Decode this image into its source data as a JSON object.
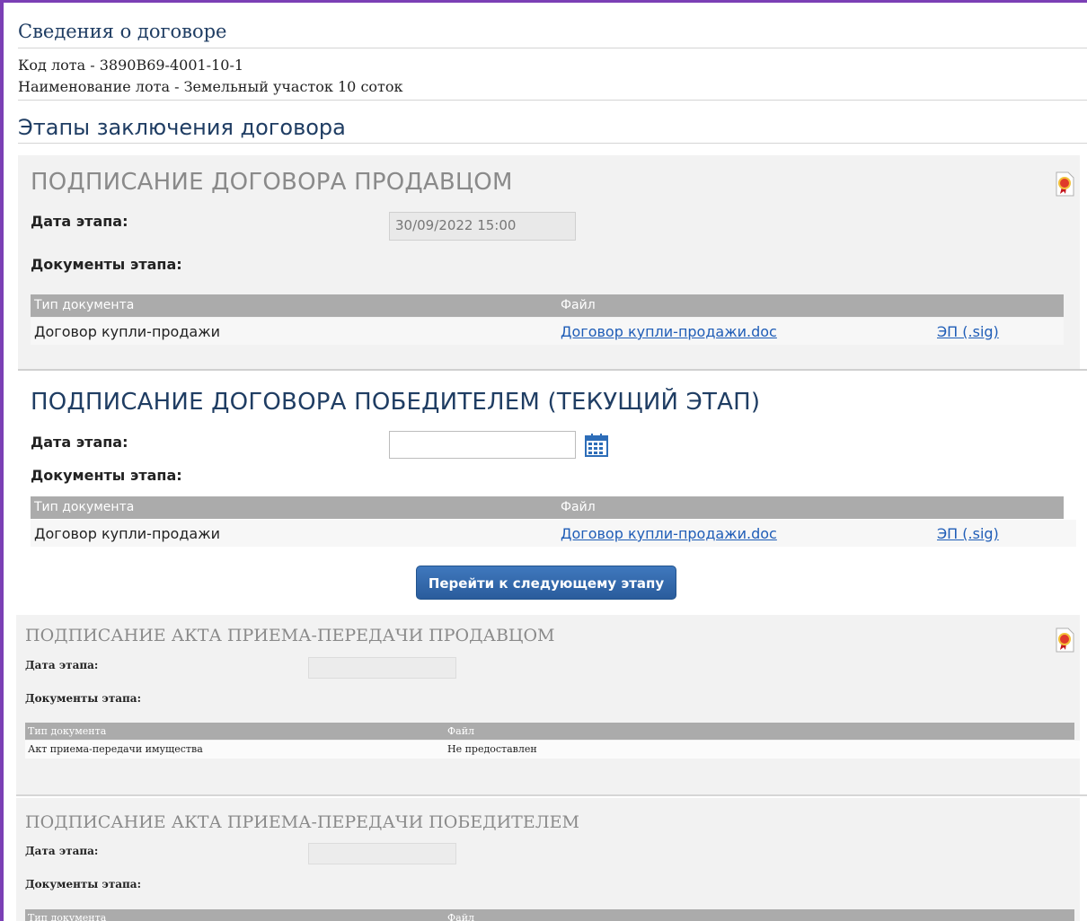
{
  "contract_info": {
    "title": "Сведения о договоре",
    "lot_code": "Код лота - 3890В69-4001-10-1",
    "lot_name": "Наименование лота - Земельный участок 10 соток"
  },
  "stages_title": "Этапы заключения договора",
  "stage1": {
    "title": "ПОДПИСАНИЕ ДОГОВОРА ПРОДАВЦОМ",
    "date_label": "Дата этапа:",
    "date_value": "30/09/2022 15:00",
    "docs_label": "Документы этапа:",
    "col_type": "Тип документа",
    "col_file": "Файл",
    "row": {
      "type": "Договор купли-продажи",
      "file": "Договор купли-продажи.doc",
      "sig": "ЭП (.sig)"
    }
  },
  "stage2": {
    "title": "ПОДПИСАНИЕ ДОГОВОРА ПОБЕДИТЕЛЕМ (ТЕКУЩИЙ ЭТАП)",
    "date_label": "Дата этапа:",
    "date_value": "",
    "docs_label": "Документы этапа:",
    "col_type": "Тип документа",
    "col_file": "Файл",
    "row": {
      "type": "Договор купли-продажи",
      "file": "Договор купли-продажи.doc",
      "sig": "ЭП (.sig)"
    },
    "next_button": "Перейти к следующему этапу"
  },
  "stage3": {
    "title": "ПОДПИСАНИЕ АКТА ПРИЕМА-ПЕРЕДАЧИ ПРОДАВЦОМ",
    "date_label": "Дата этапа:",
    "docs_label": "Документы этапа:",
    "col_type": "Тип документа",
    "col_file": "Файл",
    "row": {
      "type": "Акт приема-передачи имущества",
      "file": "Не предоставлен"
    }
  },
  "stage4": {
    "title": "ПОДПИСАНИЕ АКТА ПРИЕМА-ПЕРЕДАЧИ ПОБЕДИТЕЛЕМ",
    "date_label": "Дата этапа:",
    "docs_label": "Документы этапа:",
    "col_type": "Тип документа",
    "col_file": "Файл"
  },
  "colors": {
    "frame": "#7b3fb5",
    "heading": "#1f3d63",
    "link": "#1f5db7",
    "button": "#2f68ab",
    "table_header": "#ababab"
  },
  "icons": {
    "award": "award-ribbon-icon",
    "calendar": "calendar-icon"
  }
}
